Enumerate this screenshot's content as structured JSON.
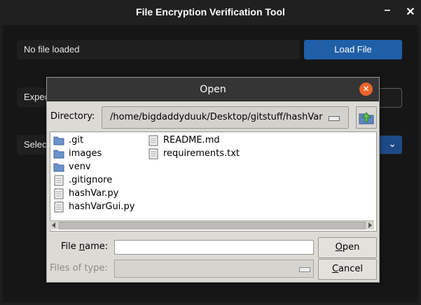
{
  "window": {
    "title": "File Encryption Verification Tool",
    "minimize_glyph": "–",
    "close_glyph": "✕"
  },
  "main": {
    "status_text": "No file loaded",
    "load_button": "Load File",
    "expected_label": "Expec",
    "select_label": "Selec",
    "select_chevron": "⌄",
    "accent_color": "#1f5fa8"
  },
  "dialog": {
    "title": "Open",
    "close_glyph": "✕",
    "directory_label": "Directory:",
    "directory_path": "/home/bigdaddyduuk/Desktop/gitstuff/hashVar",
    "files": [
      {
        "name": ".git",
        "icon": "folder-icon"
      },
      {
        "name": "images",
        "icon": "folder-icon"
      },
      {
        "name": "venv",
        "icon": "folder-icon"
      },
      {
        "name": ".gitignore",
        "icon": "file-icon"
      },
      {
        "name": "hashVar.py",
        "icon": "file-icon"
      },
      {
        "name": "hashVarGui.py",
        "icon": "file-icon"
      },
      {
        "name": "README.md",
        "icon": "file-icon"
      },
      {
        "name": "requirements.txt",
        "icon": "file-icon"
      }
    ],
    "file_name_label_pre": "File ",
    "file_name_label_u": "n",
    "file_name_label_post": "ame:",
    "file_name_value": "",
    "open_button_u": "O",
    "open_button_rest": "pen",
    "files_of_type_label": "Files of type:",
    "files_of_type_value": "",
    "cancel_button_u": "C",
    "cancel_button_rest": "ancel"
  }
}
